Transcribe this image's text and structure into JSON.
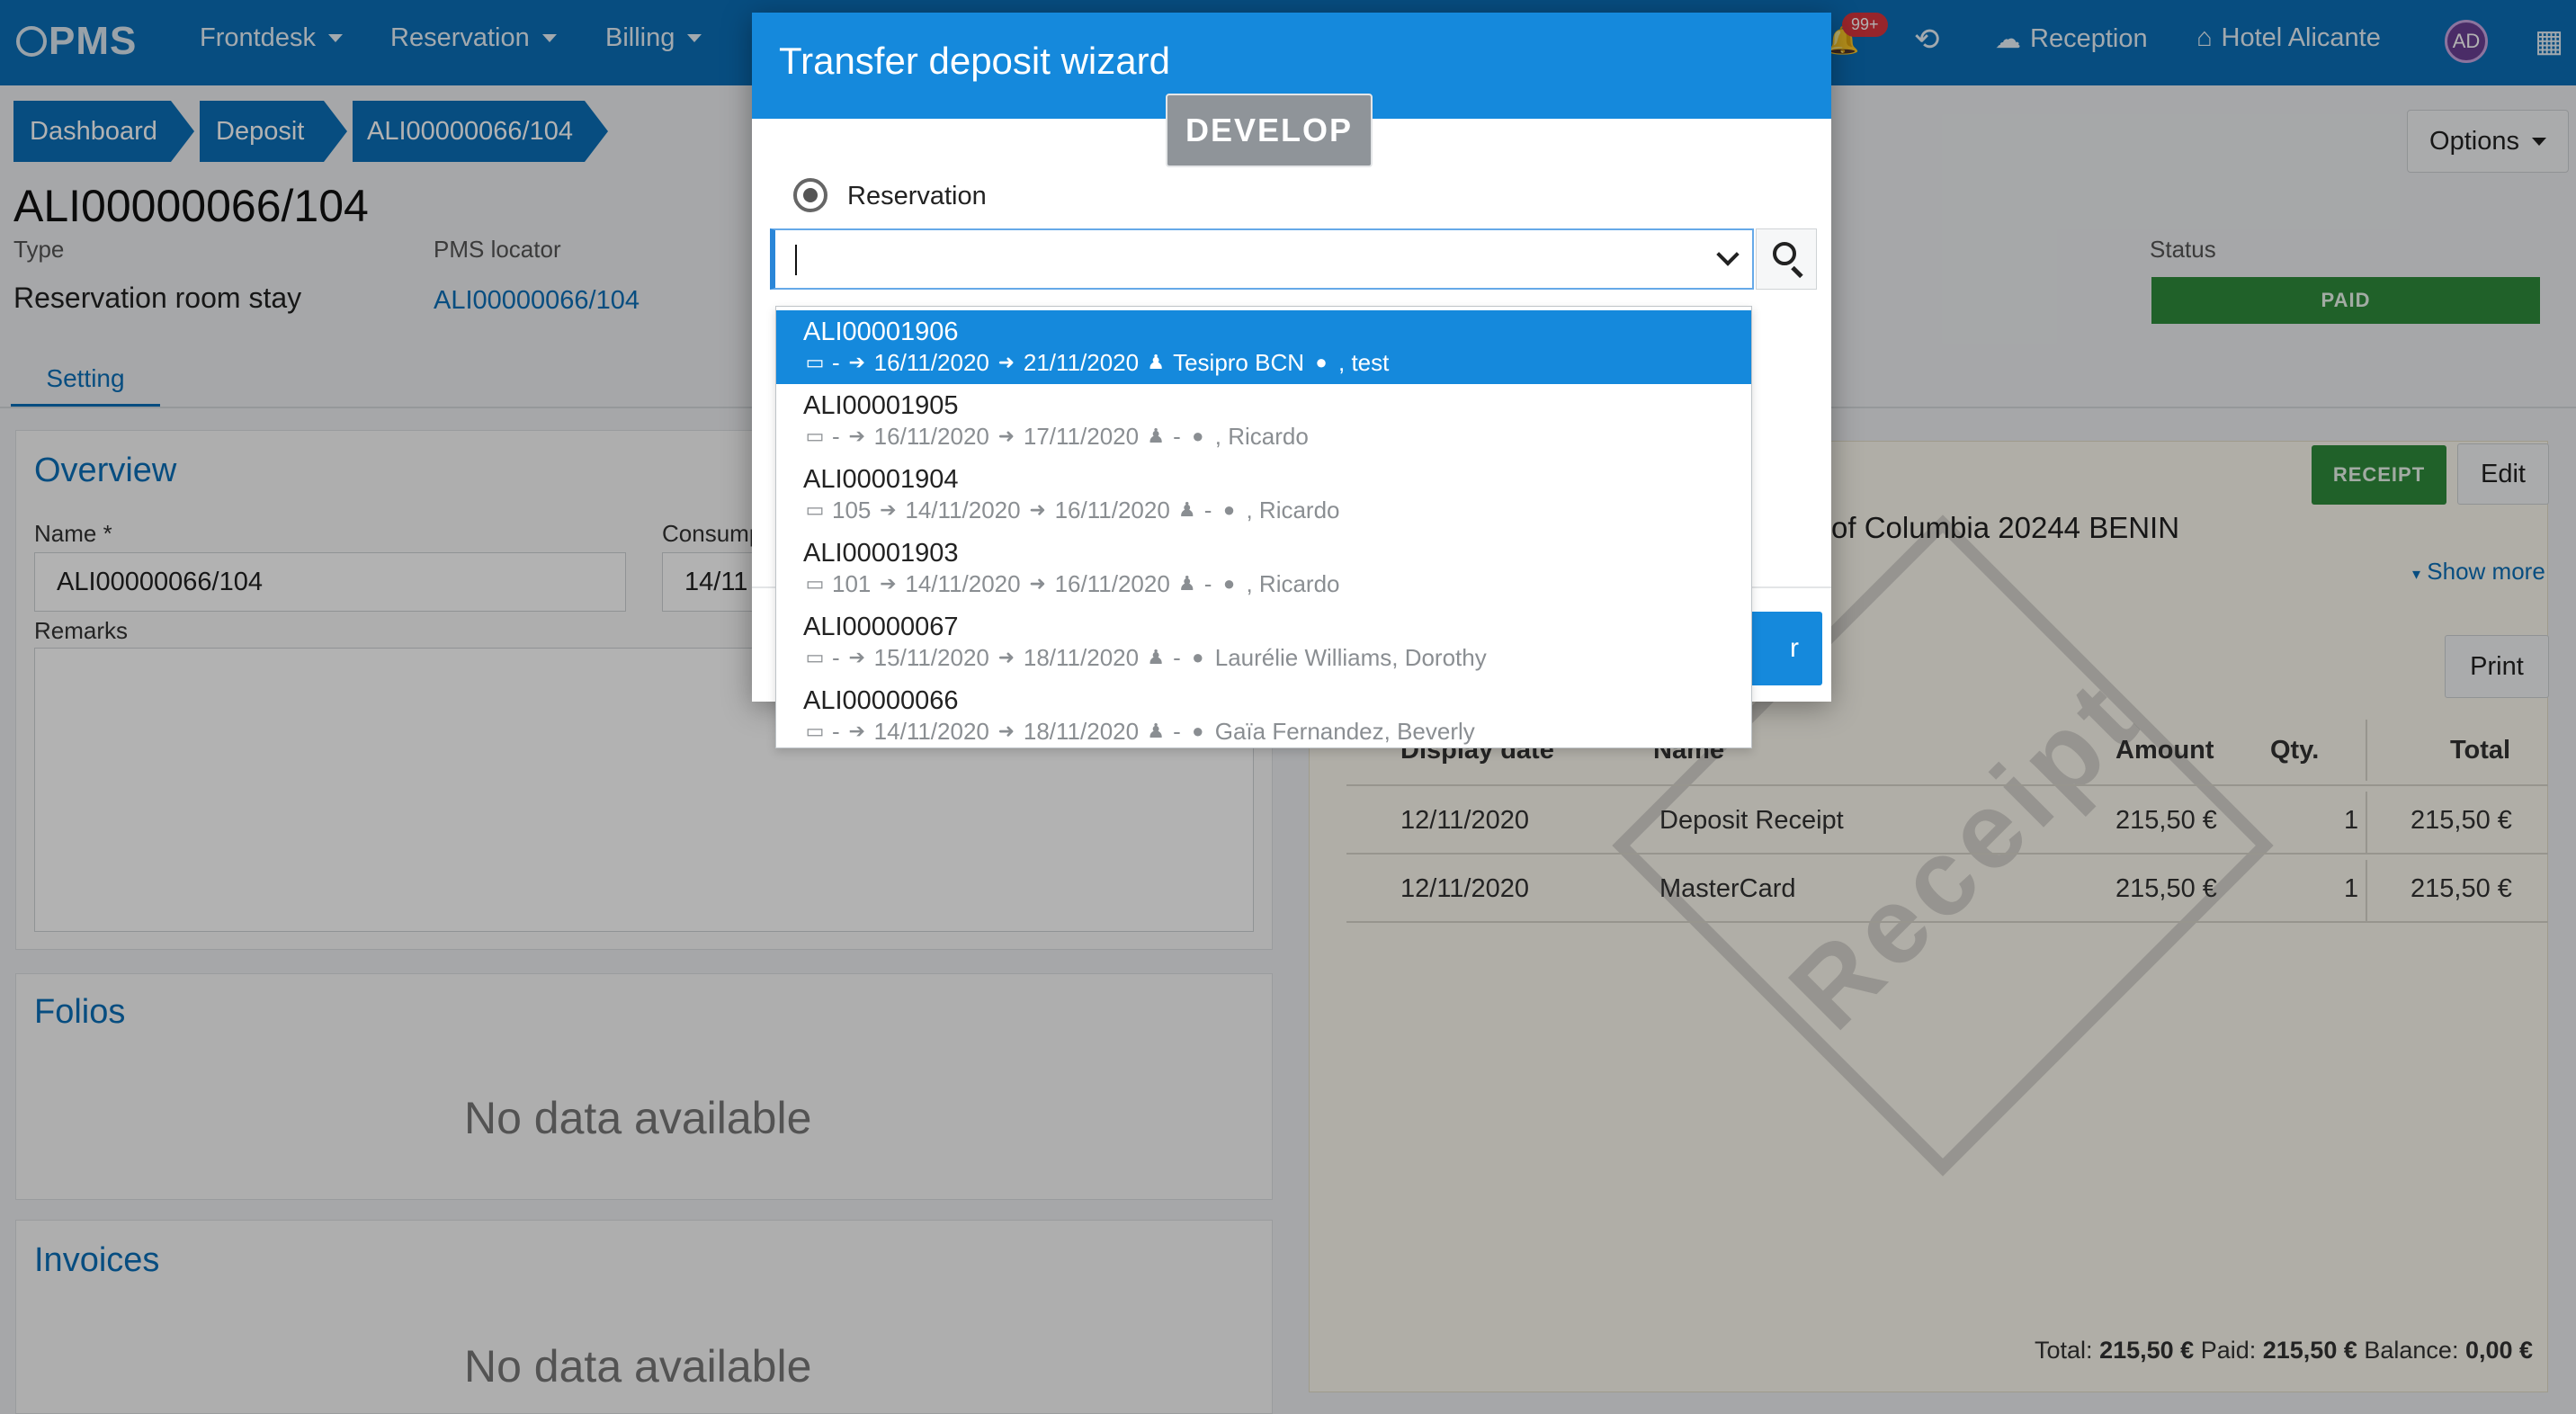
{
  "nav": {
    "logo": "PMS",
    "items": [
      "Frontdesk",
      "Reservation",
      "Billing"
    ],
    "notifications_badge": "99+",
    "reception_label": "Reception",
    "hotel_label": "Hotel Alicante",
    "avatar_initials": "AD"
  },
  "breadcrumb": [
    "Dashboard",
    "Deposit",
    "ALI00000066/104"
  ],
  "options_label": "Options",
  "page": {
    "title": "ALI00000066/104",
    "type_label": "Type",
    "type_value": "Reservation room stay",
    "locator_label": "PMS locator",
    "locator_value": "ALI00000066/104",
    "status_label": "Status",
    "status_value": "PAID"
  },
  "tabs": [
    "Setting"
  ],
  "overview": {
    "title": "Overview",
    "name_label": "Name *",
    "name_value": "ALI00000066/104",
    "consumption_label": "Consump",
    "consumption_value": "14/11",
    "remarks_label": "Remarks"
  },
  "folios": {
    "title": "Folios",
    "empty": "No data available"
  },
  "invoices": {
    "title": "Invoices",
    "empty": "No data available"
  },
  "receipt": {
    "receipt_btn": "RECEIPT",
    "edit_btn": "Edit",
    "address": "of Columbia 20244 BENIN",
    "show_more": "Show more",
    "print_btn": "Print",
    "watermark": "Receipt",
    "columns": [
      "Display date",
      "Name",
      "Amount",
      "Qty.",
      "Total"
    ],
    "rows": [
      [
        "12/11/2020",
        "Deposit Receipt",
        "215,50 €",
        "1",
        "215,50 €"
      ],
      [
        "12/11/2020",
        "MasterCard",
        "215,50 €",
        "1",
        "215,50 €"
      ]
    ],
    "totals": {
      "total_label": "Total:",
      "total_value": "215,50 €",
      "paid_label": "Paid:",
      "paid_value": "215,50 €",
      "balance_label": "Balance:",
      "balance_value": "0,00 €"
    }
  },
  "modal": {
    "title": "Transfer deposit wizard",
    "env_badge": "DEVELOP",
    "radio_label": "Reservation",
    "select_value": "",
    "next_btn": "r"
  },
  "dropdown": [
    {
      "code": "ALI00001906",
      "room": "-",
      "checkin": "16/11/2020",
      "checkout": "21/11/2020",
      "company": "Tesipro BCN",
      "guest": ", test",
      "selected": true
    },
    {
      "code": "ALI00001905",
      "room": "-",
      "checkin": "16/11/2020",
      "checkout": "17/11/2020",
      "company": "-",
      "guest": ", Ricardo",
      "selected": false
    },
    {
      "code": "ALI00001904",
      "room": "105",
      "checkin": "14/11/2020",
      "checkout": "16/11/2020",
      "company": "-",
      "guest": ", Ricardo",
      "selected": false
    },
    {
      "code": "ALI00001903",
      "room": "101",
      "checkin": "14/11/2020",
      "checkout": "16/11/2020",
      "company": "-",
      "guest": ", Ricardo",
      "selected": false
    },
    {
      "code": "ALI00000067",
      "room": "-",
      "checkin": "15/11/2020",
      "checkout": "18/11/2020",
      "company": "-",
      "guest": "Laurélie Williams, Dorothy",
      "selected": false
    },
    {
      "code": "ALI00000066",
      "room": "-",
      "checkin": "14/11/2020",
      "checkout": "18/11/2020",
      "company": "-",
      "guest": "Gaïa Fernandez, Beverly",
      "selected": false
    }
  ]
}
